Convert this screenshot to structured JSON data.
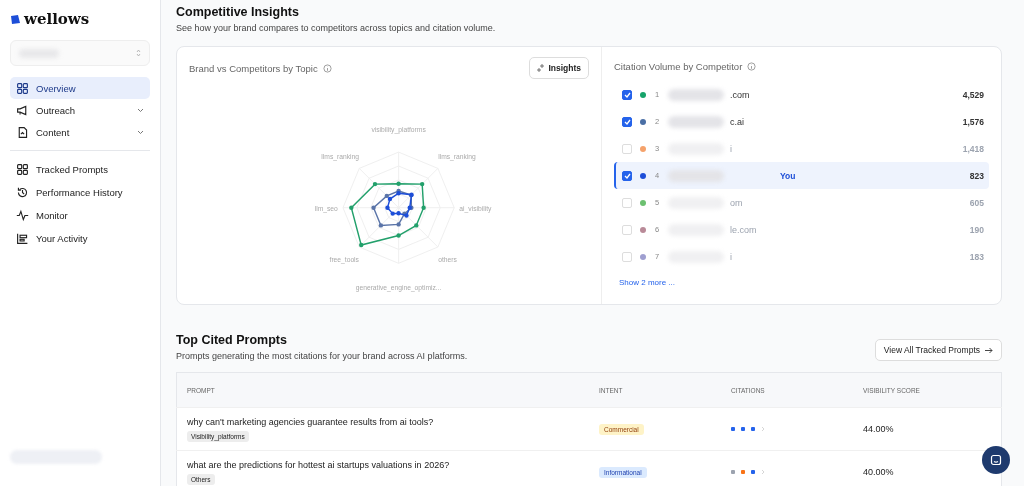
{
  "sidebar": {
    "logo": "wellows",
    "items": [
      {
        "label": "Overview",
        "selected": true,
        "expandable": false
      },
      {
        "label": "Outreach",
        "selected": false,
        "expandable": true
      },
      {
        "label": "Content",
        "selected": false,
        "expandable": true
      }
    ],
    "items_2": [
      {
        "label": "Tracked Prompts",
        "selected": false
      },
      {
        "label": "Performance History",
        "selected": false
      },
      {
        "label": "Monitor",
        "selected": false
      },
      {
        "label": "Your Activity",
        "selected": false
      }
    ]
  },
  "insights": {
    "title": "Competitive Insights",
    "subtitle": "See how your brand compares to competitors across topics and citation volume.",
    "radar": {
      "title": "Brand vs Competitors by Topic",
      "button": "Insights",
      "axes": [
        "visibility_platforms",
        "llms_ranking",
        "llms_ranking",
        "llm_seo",
        "ai_visibility",
        "free_tools",
        "others",
        "generative_engine_optimiz..."
      ]
    },
    "citations": {
      "title": "Citation Volume by Competitor",
      "rows": [
        {
          "rank": "1",
          "name": ".com",
          "count": "4,529",
          "checked": true,
          "color": "#16a36a",
          "you": false
        },
        {
          "rank": "2",
          "name": "c.ai",
          "count": "1,576",
          "checked": true,
          "color": "#4a6fa5",
          "you": false
        },
        {
          "rank": "3",
          "name": "i",
          "count": "1,418",
          "checked": false,
          "color": "#f5a26b",
          "you": false
        },
        {
          "rank": "4",
          "name": "You",
          "count": "823",
          "checked": true,
          "color": "#1d4ed8",
          "you": true
        },
        {
          "rank": "5",
          "name": "om",
          "count": "605",
          "checked": false,
          "color": "#6cc070",
          "you": false
        },
        {
          "rank": "6",
          "name": "le.com",
          "count": "190",
          "checked": false,
          "color": "#b98a98",
          "you": false
        },
        {
          "rank": "7",
          "name": "i",
          "count": "183",
          "checked": false,
          "color": "#9f9fd0",
          "you": false
        }
      ],
      "more": "Show 2 more ..."
    }
  },
  "prompts": {
    "title": "Top Cited Prompts",
    "subtitle": "Prompts generating the most citations for your brand across AI platforms.",
    "button": "View All Tracked Prompts",
    "columns": [
      "PROMPT",
      "INTENT",
      "CITATIONS",
      "VISIBILITY SCORE"
    ],
    "rows": [
      {
        "prompt": "why can't marketing agencies guarantee results from ai tools?",
        "tag": "Visibility_platforms",
        "intent": "Commercial",
        "kind": "commercial",
        "sources": [
          {
            "color": "#2563eb"
          },
          {
            "color": "#2563eb"
          },
          {
            "color": "#2563eb"
          }
        ],
        "score": "44.00%"
      },
      {
        "prompt": "what are the predictions for hottest ai startups valuations in 2026?",
        "tag": "Others",
        "intent": "Informational",
        "kind": "informational",
        "sources": [
          {
            "color": "#9ca3af"
          },
          {
            "color": "#f97316"
          },
          {
            "color": "#2563eb"
          }
        ],
        "score": "40.00%"
      }
    ]
  }
}
